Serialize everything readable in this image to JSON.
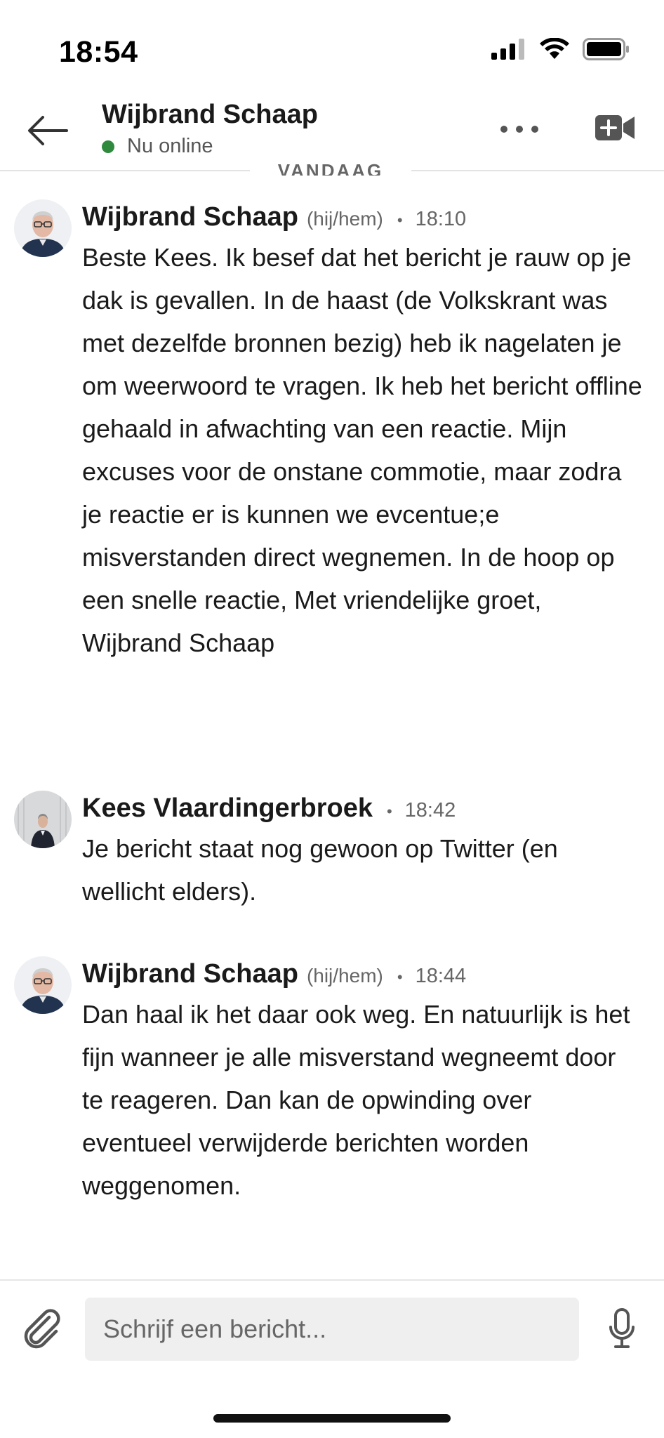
{
  "status_bar": {
    "time": "18:54",
    "icons": [
      "cellular-signal-icon",
      "wifi-icon",
      "battery-icon"
    ]
  },
  "header": {
    "back_icon": "arrow-left-icon",
    "contact_name": "Wijbrand Schaap",
    "presence_text": "Nu online",
    "presence_color": "#2f8a3e",
    "more_icon": "more-horizontal-icon",
    "video_icon": "video-call-add-icon"
  },
  "day_separator": "VANDAAG",
  "messages": [
    {
      "sender": "Wijbrand Schaap",
      "pronouns": "(hij/hem)",
      "separator": "•",
      "time": "18:10",
      "text": "Beste Kees. Ik besef dat het bericht je rauw op je dak is gevallen. In de haast (de Volkskrant was met dezelfde bronnen bezig) heb ik nagelaten je om weerwoord te vragen. Ik heb het bericht offline gehaald in afwachting van een reactie. Mijn excuses voor de onstane commotie, maar zodra je reactie er is kunnen we evcentue;e misverstanden direct wegnemen. In de hoop op een snelle reactie, Met vriendelijke groet, Wijbrand Schaap"
    },
    {
      "sender": "Kees Vlaardingerbroek",
      "pronouns": "",
      "separator": "•",
      "time": "18:42",
      "text": "Je bericht staat nog gewoon op Twitter (en wellicht elders)."
    },
    {
      "sender": "Wijbrand Schaap",
      "pronouns": "(hij/hem)",
      "separator": "•",
      "time": "18:44",
      "text": "Dan haal ik het daar ook weg. En natuurlijk is het fijn wanneer je alle misverstand wegneemt door te reageren. Dan kan de opwinding over eventueel verwijderde berichten worden weggenomen."
    }
  ],
  "composer": {
    "attach_icon": "paperclip-icon",
    "placeholder": "Schrijf een bericht...",
    "mic_icon": "microphone-icon"
  }
}
